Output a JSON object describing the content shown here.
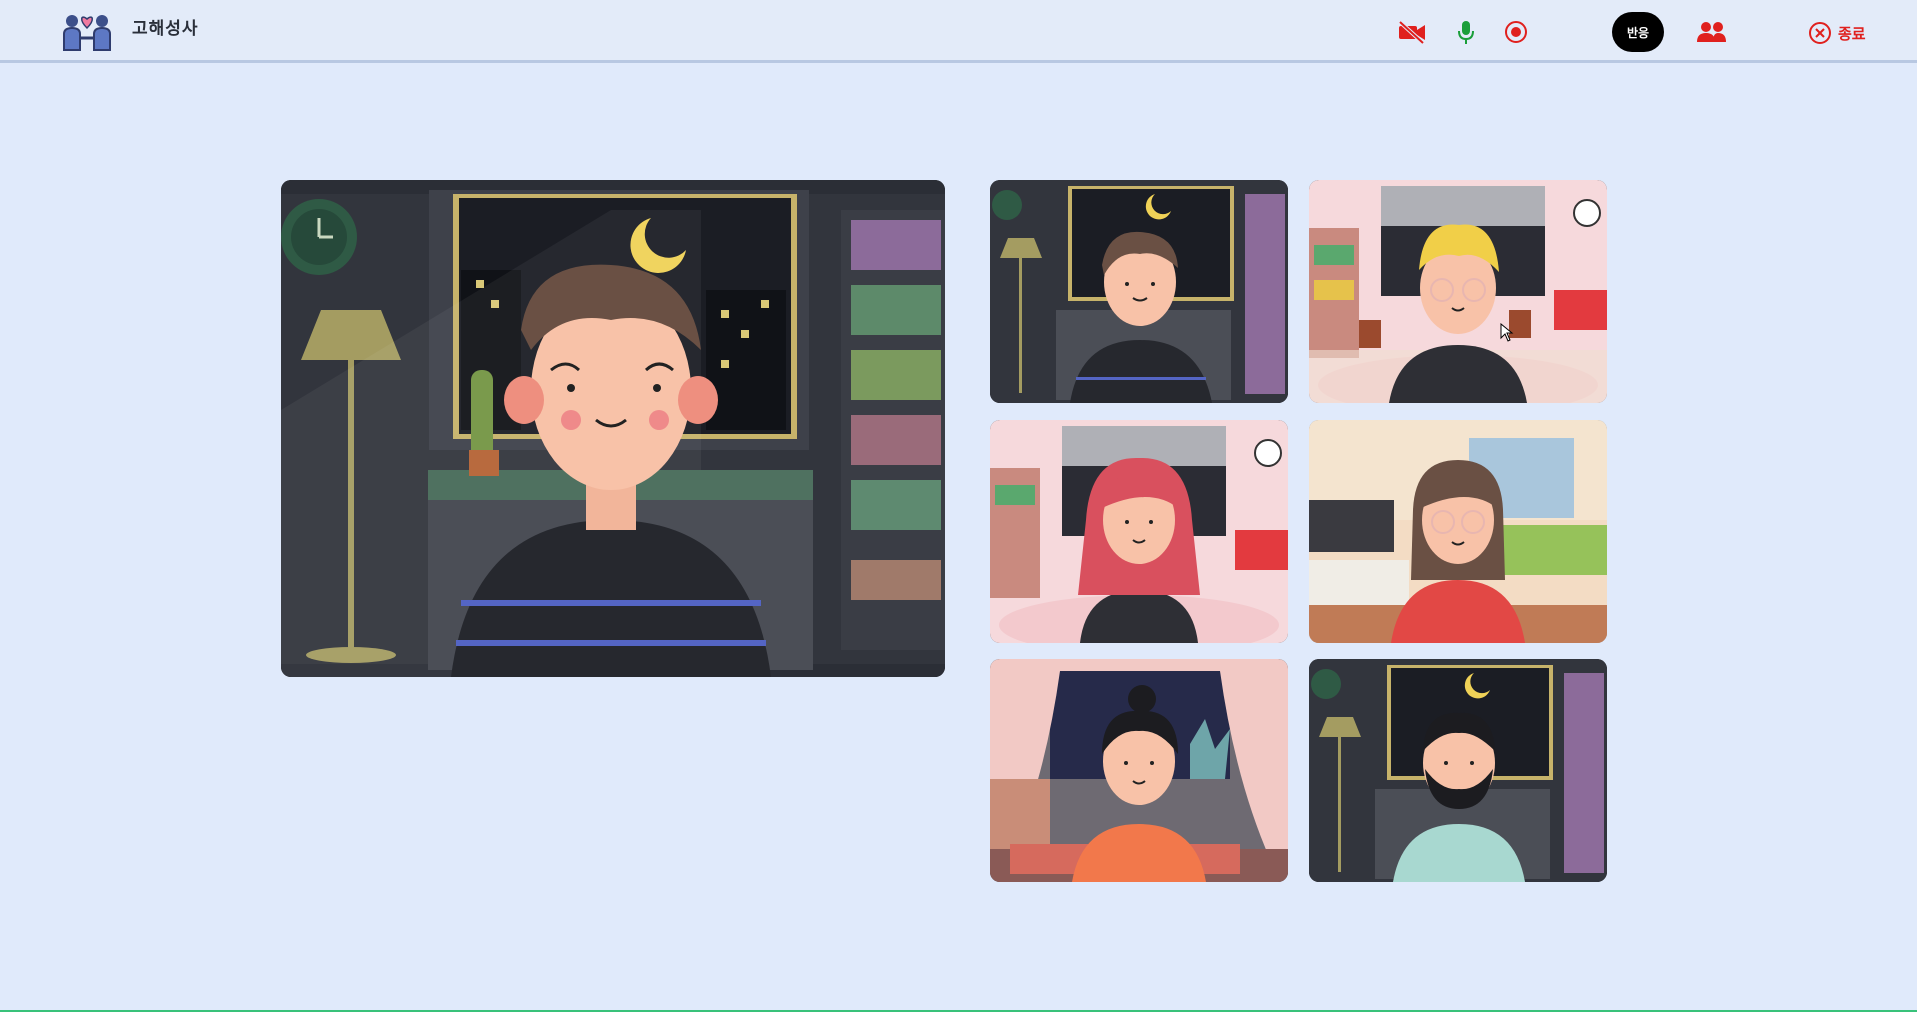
{
  "header": {
    "app_title": "고해성사",
    "icons": [
      "people-heart-logo",
      "video-off-icon",
      "mic-icon",
      "record-icon",
      "participants-icon",
      "close-circle-icon"
    ],
    "react_label": "반응",
    "exit_label": "종료"
  },
  "colors": {
    "background": "#e0eafb",
    "accent_red": "#e0201e",
    "mic_green": "#1a9e3a",
    "react_bg": "#000000"
  },
  "main_video": {
    "participant": "main"
  },
  "grid_tiles": [
    {
      "scene": "night-room",
      "person": "man-brown-hair"
    },
    {
      "scene": "living-room-pink",
      "person": "man-blonde-glasses"
    },
    {
      "scene": "living-room-pink",
      "person": "woman-red-hair"
    },
    {
      "scene": "tv-room",
      "person": "woman-glasses"
    },
    {
      "scene": "curtain-room",
      "person": "woman-bun"
    },
    {
      "scene": "night-room",
      "person": "man-beard"
    }
  ]
}
